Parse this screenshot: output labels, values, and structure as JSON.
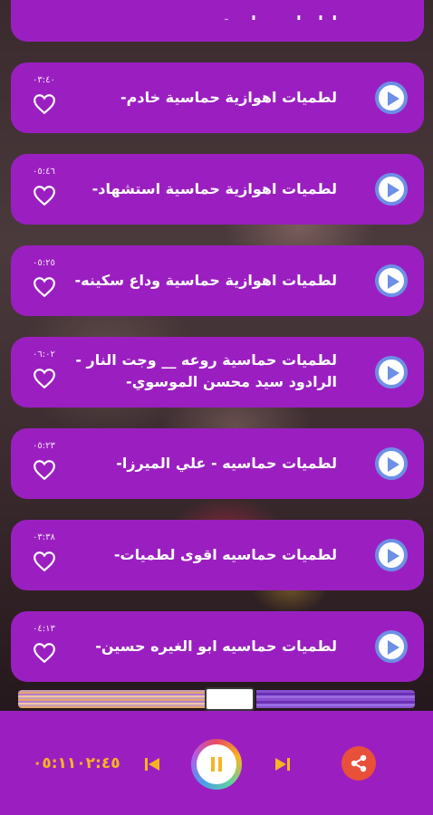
{
  "tracks": [
    {
      "title": "لطميات اهوازية حماسية  خادم-",
      "duration": "٠٣:٤٠"
    },
    {
      "title": "لطميات اهوازية حماسية استشهاد-",
      "duration": "٠٥:٤٦"
    },
    {
      "title": "لطميات اهوازية حماسية وداع سكينه-",
      "duration": "٠٥:٢٥"
    },
    {
      "title": "لطميات حماسية روعه __ وجت النار - الرادود سيد محسن الموسوي-",
      "duration": "٠٦:٠٢"
    },
    {
      "title": "لطميات حماسيه  - علي الميرزا-",
      "duration": "٠٥:٢٣"
    },
    {
      "title": "لطميات حماسيه  اقوى لطميات-",
      "duration": "٠٣:٣٨"
    },
    {
      "title": "لطميات حماسيه ابو الغيره حسين-",
      "duration": "٠٤:١٣"
    }
  ],
  "top_partial": {
    "title": "لطميات حماسية حسين حسين-"
  },
  "player": {
    "time": "٠٥:١١٠٢:٤٥",
    "progress": 0.47
  },
  "colors": {
    "card": "#9b1fc0",
    "accent_time": "#f5b522",
    "share": "#e8503a",
    "play_ring": "#6d8fe6"
  },
  "icons": {
    "play": "play-icon",
    "heart": "heart-outline-icon",
    "pause": "pause-icon",
    "prev": "skip-previous-icon",
    "next": "skip-next-icon",
    "share": "share-icon"
  }
}
